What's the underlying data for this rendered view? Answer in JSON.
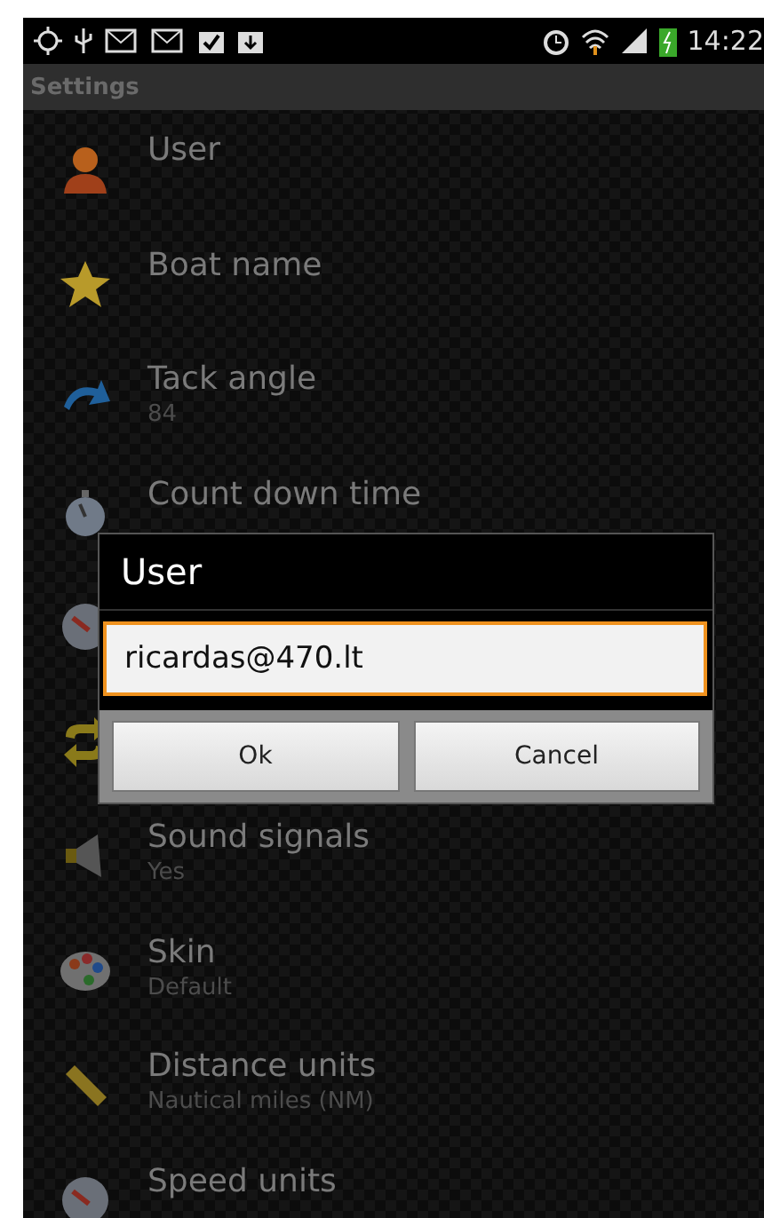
{
  "status_bar": {
    "time": "14:22"
  },
  "title_bar": {
    "title": "Settings"
  },
  "settings": [
    {
      "kind": "person",
      "title": "User"
    },
    {
      "kind": "star",
      "title": "Boat name"
    },
    {
      "kind": "arrow",
      "title": "Tack angle",
      "summary": "84"
    },
    {
      "kind": "stopwatch",
      "title": "Count down time"
    },
    {
      "kind": "gauge"
    },
    {
      "kind": "swap"
    },
    {
      "kind": "speaker",
      "title": "Sound signals",
      "summary": "Yes"
    },
    {
      "kind": "palette",
      "title": "Skin",
      "summary": "Default"
    },
    {
      "kind": "ruler",
      "title": "Distance units",
      "summary": "Nautical miles (NM)"
    },
    {
      "kind": "gauge",
      "title": "Speed units"
    }
  ],
  "dialog": {
    "title": "User",
    "value": "ricardas@470.lt",
    "buttons": [
      "Ok",
      "Cancel"
    ]
  }
}
